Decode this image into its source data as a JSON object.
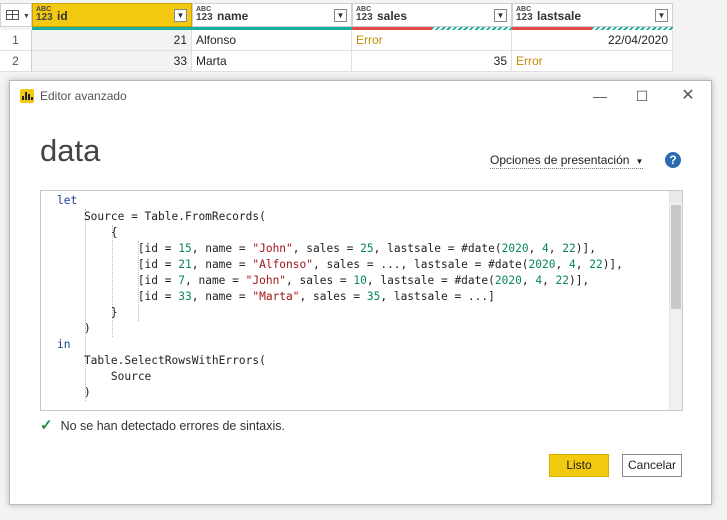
{
  "grid": {
    "columns": [
      {
        "type_top": "ABC",
        "type_bottom": "123",
        "name": "id",
        "selected": true
      },
      {
        "type_top": "ABC",
        "type_bottom": "123",
        "name": "name",
        "selected": false
      },
      {
        "type_top": "ABC",
        "type_bottom": "123",
        "name": "sales",
        "selected": false
      },
      {
        "type_top": "ABC",
        "type_bottom": "123",
        "name": "lastsale",
        "selected": false
      }
    ],
    "rows": [
      {
        "num": "1",
        "id": "21",
        "name": "Alfonso",
        "sales": "Error",
        "lastsale": "22/04/2020"
      },
      {
        "num": "2",
        "id": "33",
        "name": "Marta",
        "sales": "35",
        "lastsale": "Error"
      }
    ],
    "quality_colors": {
      "valid": "#1aaf9c",
      "error": "#e24b4b"
    }
  },
  "dialog": {
    "window_title": "Editor avanzado",
    "query_name": "data",
    "options_label": "Opciones de presentación",
    "help_label": "?",
    "code_lines": [
      "let",
      "    Source = Table.FromRecords(",
      "        {",
      "            [id = 15, name = \"John\", sales = 25, lastsale = #date(2020, 4, 22)],",
      "            [id = 21, name = \"Alfonso\", sales = ..., lastsale = #date(2020, 4, 22)],",
      "            [id = 7, name = \"John\", sales = 10, lastsale = #date(2020, 4, 22)],",
      "            [id = 33, name = \"Marta\", sales = 35, lastsale = ...]",
      "        }",
      "    )",
      "in",
      "    Table.SelectRowsWithErrors(",
      "        Source",
      "    )"
    ],
    "status_text": "No se han detectado errores de sintaxis.",
    "ok_label": "Listo",
    "cancel_label": "Cancelar",
    "accent_color": "#f2c811"
  }
}
